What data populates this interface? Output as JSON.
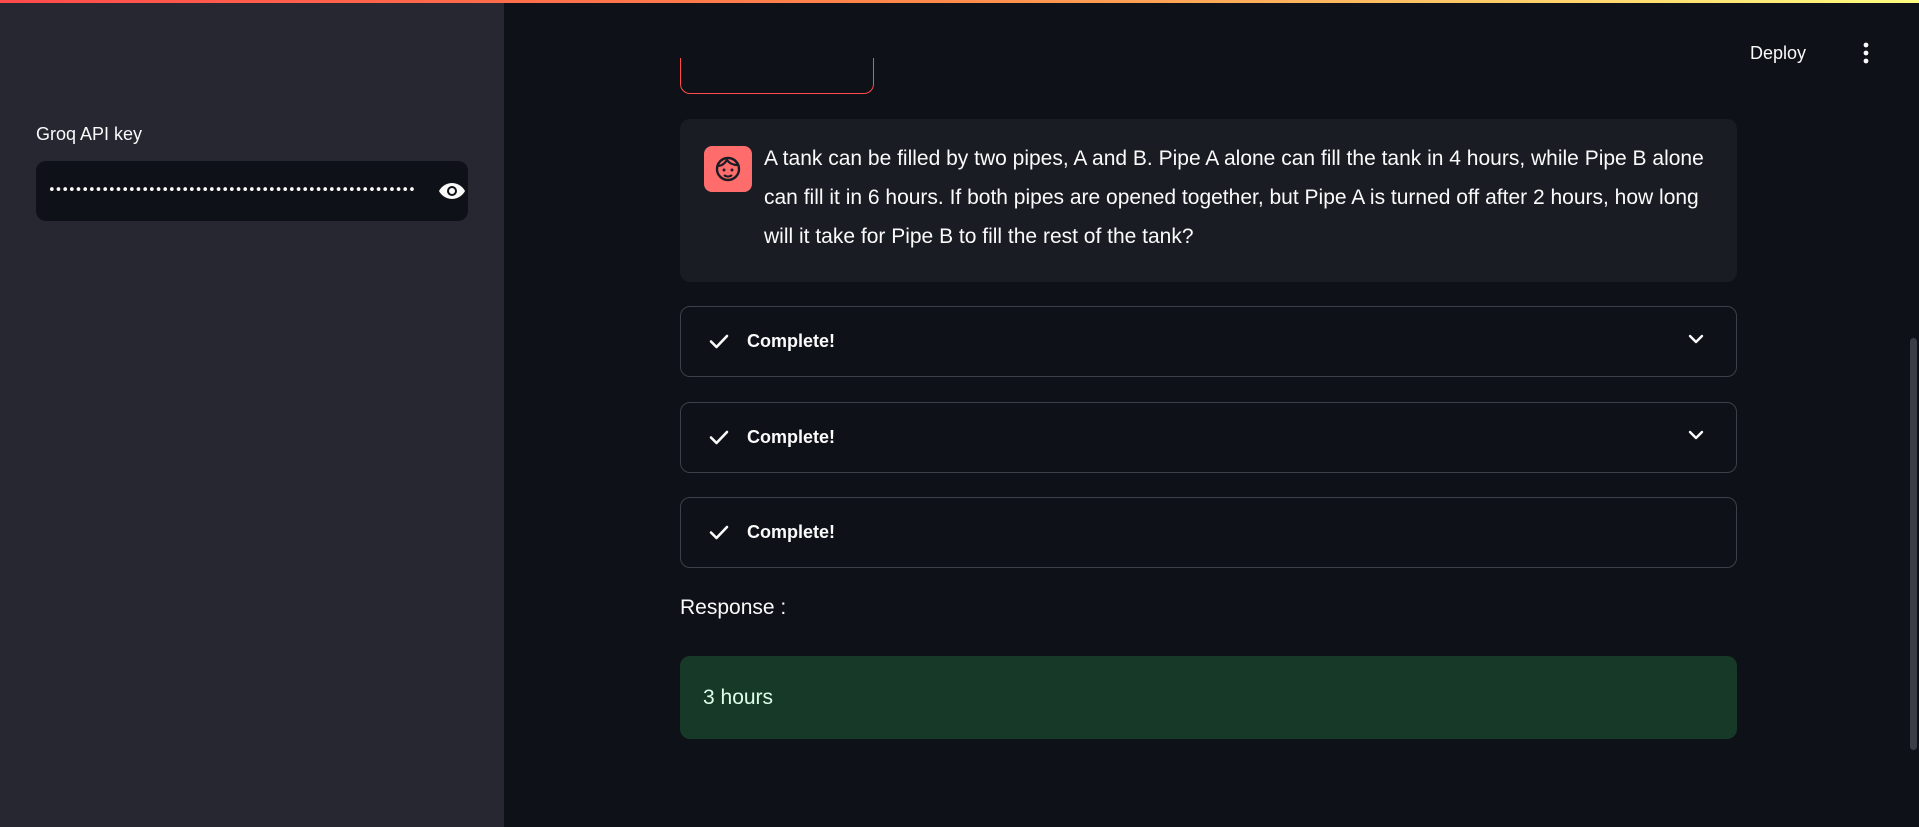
{
  "sidebar": {
    "api_key_label": "Groq API key",
    "api_key_masked": "••••••••••••••••••••••••••••••••••••••••••••••••••••••••••"
  },
  "header": {
    "deploy_label": "Deploy"
  },
  "chat": {
    "user_message": "A tank can be filled by two pipes, A and B. Pipe A alone can fill the tank in 4 hours, while Pipe B alone can fill it in 6 hours. If both pipes are opened together, but Pipe A is turned off after 2 hours, how long will it take for Pipe B to fill the rest of the tank?"
  },
  "steps": [
    {
      "label": "Complete!",
      "has_chevron": true
    },
    {
      "label": "Complete!",
      "has_chevron": true
    },
    {
      "label": "Complete!",
      "has_chevron": false
    }
  ],
  "response": {
    "label": "Response :",
    "value": "3 hours"
  },
  "colors": {
    "accent": "#ff4b4b",
    "avatar_bg": "#ff6c6c",
    "success_bg": "#173928",
    "sidebar_bg": "#262730",
    "main_bg": "#0e1117"
  },
  "icons": {
    "password_toggle": "eye-icon",
    "main_menu": "kebab-menu-icon",
    "avatar": "user-face-icon",
    "step_status": "check-icon",
    "expand": "chevron-down-icon"
  }
}
